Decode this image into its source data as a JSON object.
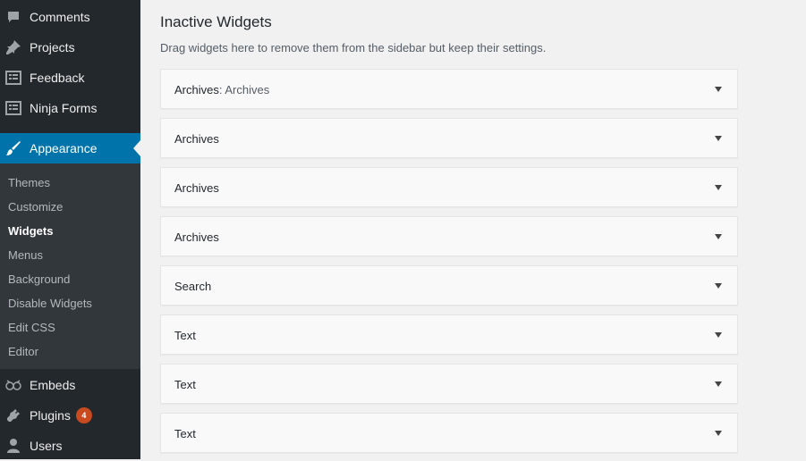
{
  "sidebar": {
    "comments": "Comments",
    "projects": "Projects",
    "feedback": "Feedback",
    "ninja_forms": "Ninja Forms",
    "appearance": "Appearance",
    "submenu": [
      "Themes",
      "Customize",
      "Widgets",
      "Menus",
      "Background",
      "Disable Widgets",
      "Edit CSS",
      "Editor"
    ],
    "embeds": "Embeds",
    "plugins": "Plugins",
    "plugins_badge": "4",
    "users": "Users"
  },
  "main": {
    "title": "Inactive Widgets",
    "description": "Drag widgets here to remove them from the sidebar but keep their settings.",
    "widgets": [
      {
        "name": "Archives",
        "subtitle": ": Archives"
      },
      {
        "name": "Archives",
        "subtitle": ""
      },
      {
        "name": "Archives",
        "subtitle": ""
      },
      {
        "name": "Archives",
        "subtitle": ""
      },
      {
        "name": "Search",
        "subtitle": ""
      },
      {
        "name": "Text",
        "subtitle": ""
      },
      {
        "name": "Text",
        "subtitle": ""
      },
      {
        "name": "Text",
        "subtitle": ""
      }
    ]
  },
  "colors": {
    "sidebar_bg": "#23282d",
    "submenu_bg": "#32373c",
    "accent": "#0073aa",
    "badge": "#ca4a1f"
  }
}
